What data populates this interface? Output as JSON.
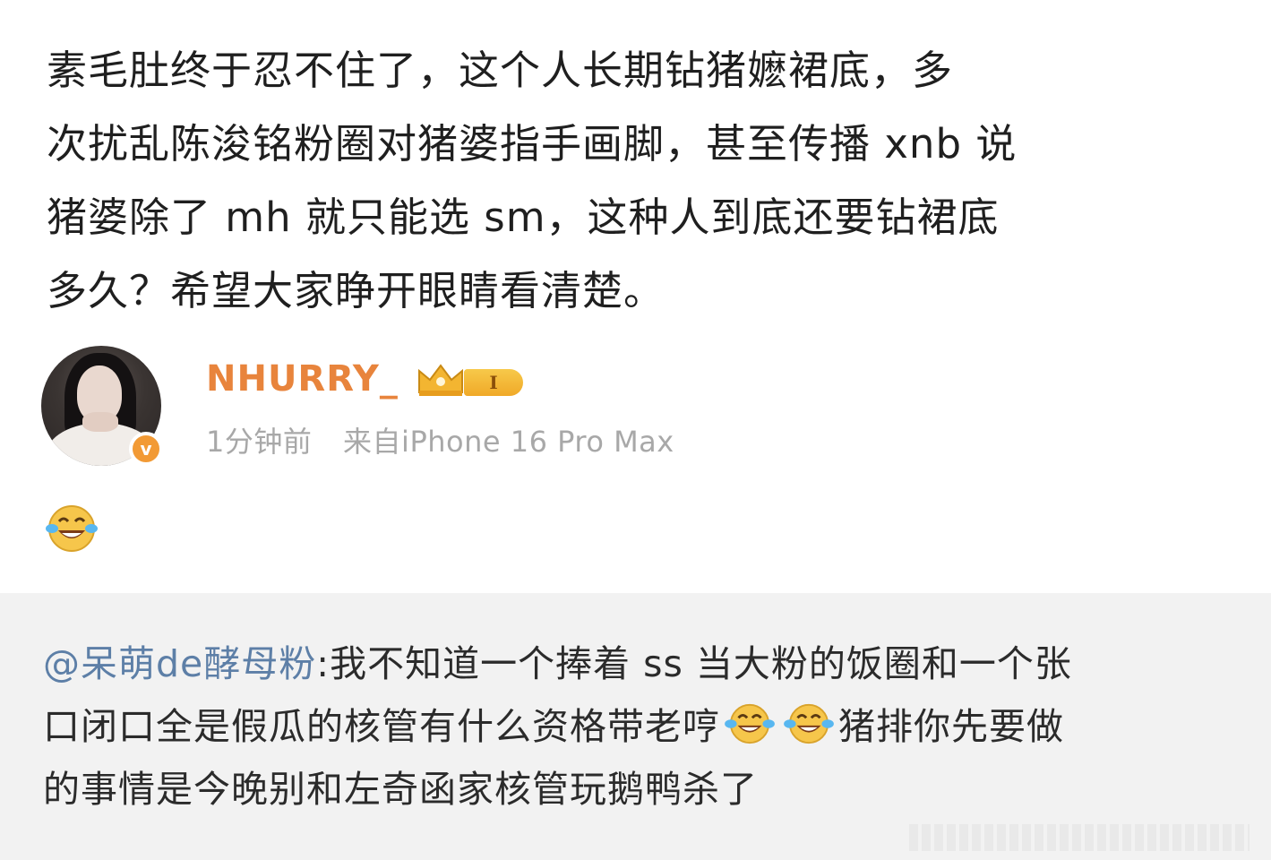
{
  "post": {
    "lines": [
      "素毛肚终于忍不住了，这个人长期钻猪嬷裙底，多",
      "次扰乱陈浚铭粉圈对猪婆指手画脚，甚至传播 xnb 说",
      "猪婆除了 mh 就只能选 sm，这种人到底还要钻裙底",
      "多久？希望大家睁开眼睛看清楚。"
    ]
  },
  "author": {
    "username": "NHURRY_",
    "level": "I",
    "time": "1分钟前",
    "source": "来自iPhone 16 Pro Max",
    "avatar_icon": "user-avatar",
    "verified_icon": "verified-v-icon",
    "colors": {
      "username": "#e8843c",
      "verified": "#f29a35",
      "level_badge": "#f0a928"
    }
  },
  "reply": {
    "emoji": "laugh-cry-emoji"
  },
  "quote": {
    "mention": "@呆萌de酵母粉",
    "line1_rest": ":我不知道一个捧着 ss 当大粉的饭圈和一个张",
    "line2_before": "口闭口全是假瓜的核管有什么资格带老哼",
    "line2_after": "猪排你先要做",
    "line3": "的事情是今晚别和左奇函家核管玩鹅鸭杀了",
    "mention_color": "#5d7fa7",
    "background": "#f2f2f2"
  }
}
